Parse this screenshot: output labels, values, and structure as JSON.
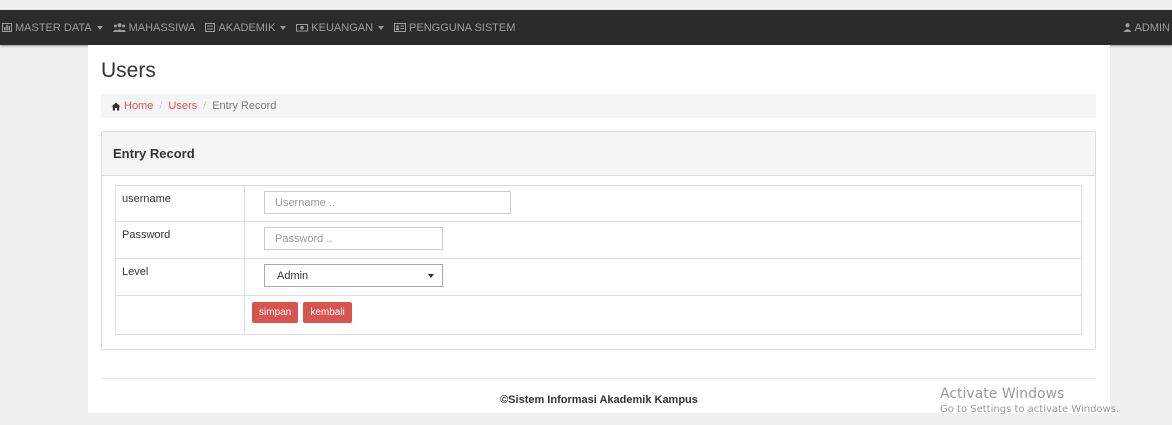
{
  "navbar": {
    "items": [
      {
        "label": "MASTER DATA",
        "icon": "bar-chart-icon",
        "dropdown": true
      },
      {
        "label": "MAHASSIWA",
        "icon": "users-icon",
        "dropdown": false
      },
      {
        "label": "AKADEMIK",
        "icon": "list-icon",
        "dropdown": true
      },
      {
        "label": "KEUANGAN",
        "icon": "money-icon",
        "dropdown": true
      },
      {
        "label": "PENGGUNA SISTEM",
        "icon": "user-card-icon",
        "dropdown": false
      }
    ],
    "user_label": "ADMIN",
    "user_icon": "user-icon"
  },
  "page": {
    "title": "Users"
  },
  "breadcrumb": {
    "home": "Home",
    "users": "Users",
    "current": "Entry Record"
  },
  "panel": {
    "title": "Entry Record"
  },
  "form": {
    "username_label": "username",
    "username_placeholder": "Username ..",
    "username_value": "",
    "password_label": "Password",
    "password_placeholder": "Password ..",
    "password_value": "",
    "level_label": "Level",
    "level_value": "Admin",
    "save_label": "simpan",
    "back_label": "kembali"
  },
  "footer": {
    "text": "©Sistem Informasi Akademik Kampus"
  },
  "watermark": {
    "line1": "Activate Windows",
    "line2": "Go to Settings to activate Windows."
  },
  "colors": {
    "navbar_bg": "#2b2b2b",
    "accent": "#d9534f",
    "page_bg": "#f0f0f0"
  }
}
